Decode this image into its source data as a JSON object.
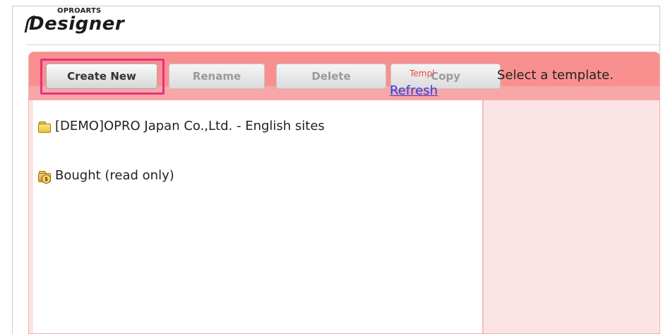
{
  "app": {
    "brand_small": "OPROARTS",
    "brand_name": "Designer"
  },
  "toolbar": {
    "create_new_label": "Create New",
    "rename_label": "Rename",
    "delete_label": "Delete",
    "copy_label": "Copy",
    "highlight_color": "#ea2f7e",
    "toolbar_color": "#f99090"
  },
  "tree": {
    "items": [
      {
        "label": "[DEMO]OPRO Japan Co.,Ltd. - English sites",
        "icon": "folder-icon"
      },
      {
        "label": "Bought (read only)",
        "icon": "purchased-folder-icon"
      }
    ],
    "template_tag": "Templ",
    "refresh_label": "Refresh"
  },
  "detail": {
    "message": "Select a template."
  }
}
